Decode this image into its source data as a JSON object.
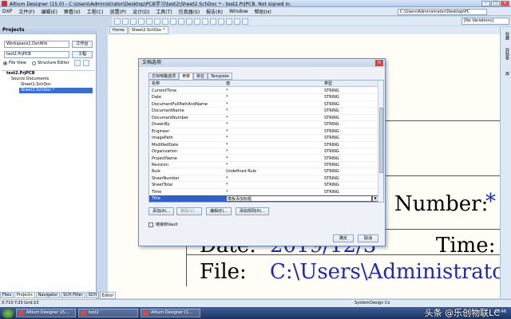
{
  "window": {
    "title": "Altium Designer (15.0) - C:\\Users\\Administrator\\Desktop\\PCB学习\\test2\\Sheet2.SchDoc * - test2.PrjPCB. Not signed in.",
    "path_box": "C:\\Users\\Administrator\\Desktop\\PC",
    "variations": "[No Variations]"
  },
  "menu": [
    "DXP",
    "文件(F)",
    "编辑(E)",
    "察看(V)",
    "工程(C)",
    "放置(P)",
    "设计(D)",
    "工具(T)",
    "仿真器(S)",
    "报告(R)",
    "Window",
    "帮助(H)"
  ],
  "projects_panel": {
    "title": "Projects",
    "workspace": "Workspace1.DsnWrk",
    "workspace_btn": "工作台",
    "project": "test2.PrjPCB",
    "project_btn": "工程",
    "view_file": "File View",
    "view_structure": "Structure Editor",
    "tree": {
      "root": "test2.PrjPCB",
      "folder": "Source Documents",
      "doc1": "Sheet1.SchDoc",
      "doc2": "Sheet2.SchDoc *"
    },
    "bottom_tabs": [
      "Files",
      "Projects",
      "Navigator",
      "SCH Filter",
      "SCH"
    ]
  },
  "doc_tabs": [
    "Home",
    "Sheet2.SchDoc *"
  ],
  "editor_tab": "Editor",
  "status": {
    "coords": "X:710 Y:20",
    "grid": "Grid:10",
    "system": "System",
    "design_compiler": "Design Co"
  },
  "sheet": {
    "number_label": "Number:",
    "number_star": "*",
    "date_label": "Date:",
    "date_value": "2019/12/3",
    "time_label": "Time:",
    "file_label": "File:",
    "file_value": "C:\\Users\\Administrato"
  },
  "right_tabs": [
    "收藏",
    "剪贴板",
    "库"
  ],
  "dialog": {
    "title": "文档选项",
    "tabs": [
      "方块电路选项",
      "参数",
      "单位",
      "Template"
    ],
    "columns": [
      "名称",
      "值",
      "类型"
    ],
    "rows": [
      {
        "name": "CurrentTime",
        "value": "*",
        "type": "STRING"
      },
      {
        "name": "Date",
        "value": "*",
        "type": "STRING"
      },
      {
        "name": "DocumentFullPathAndName",
        "value": "*",
        "type": "STRING"
      },
      {
        "name": "DocumentName",
        "value": "*",
        "type": "STRING"
      },
      {
        "name": "DocumentNumber",
        "value": "*",
        "type": "STRING"
      },
      {
        "name": "DrawnBy",
        "value": "*",
        "type": "STRING"
      },
      {
        "name": "Engineer",
        "value": "*",
        "type": "STRING"
      },
      {
        "name": "ImagePath",
        "value": "*",
        "type": "STRING"
      },
      {
        "name": "ModifiedDate",
        "value": "*",
        "type": "STRING"
      },
      {
        "name": "Organization",
        "value": "*",
        "type": "STRING"
      },
      {
        "name": "ProjectName",
        "value": "*",
        "type": "STRING"
      },
      {
        "name": "Revision",
        "value": "*",
        "type": "STRING"
      },
      {
        "name": "Rule",
        "value": "Undefined Rule",
        "type": "STRING"
      },
      {
        "name": "SheetNumber",
        "value": "*",
        "type": "STRING"
      },
      {
        "name": "SheetTotal",
        "value": "*",
        "type": "STRING"
      },
      {
        "name": "Time",
        "value": "*",
        "type": "STRING"
      },
      {
        "name": "Title",
        "value": "模板添加标题",
        "type": "STRING"
      }
    ],
    "buttons": {
      "add": "添加(A)...",
      "remove": "移除(V)...",
      "edit": "编辑(E)...",
      "add_rule": "添加规则(R)...",
      "ok": "确定",
      "cancel": "取消"
    },
    "vault_checkbox": "链接到Vault"
  },
  "taskbar": {
    "items": [
      "Altium Designer 15....",
      "test2",
      "Altium Designer (1..."
    ],
    "watermark": "头条 @乐创物联LC",
    "clock": "18:46"
  }
}
